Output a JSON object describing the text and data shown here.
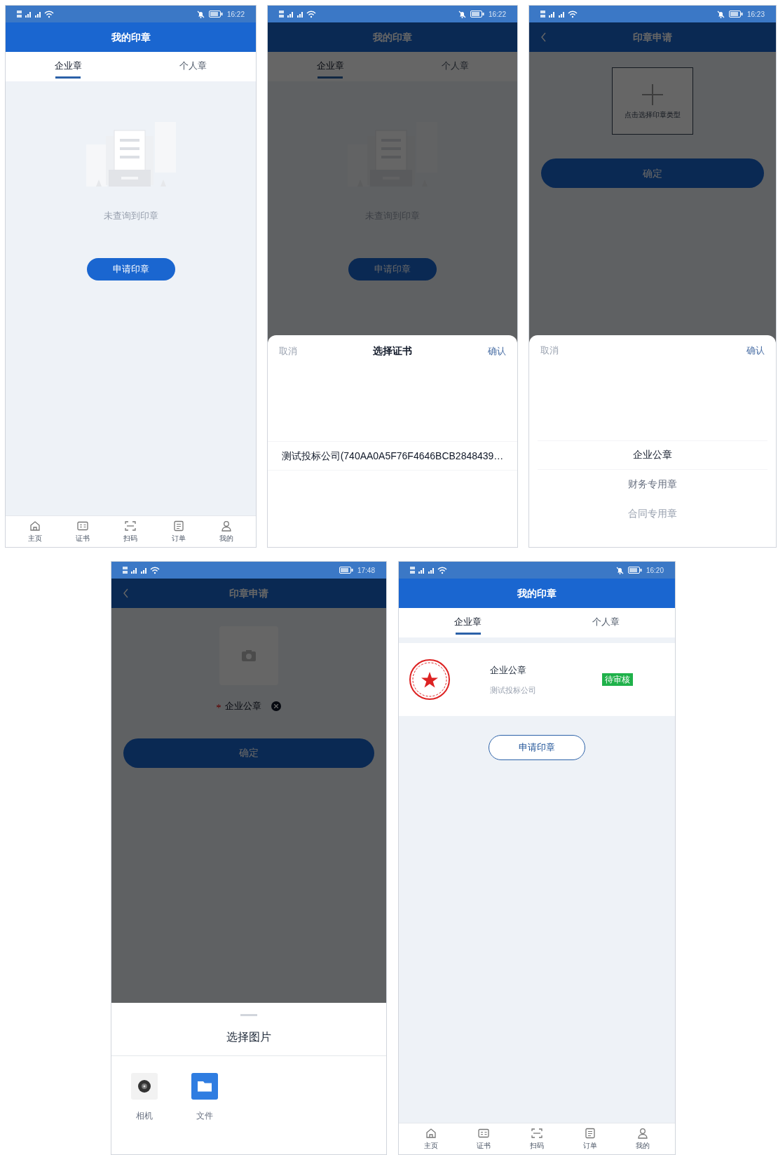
{
  "screens": [
    {
      "status_bar": {
        "time": "16:22",
        "muted": true
      },
      "header": {
        "title": "我的印章",
        "back": false
      },
      "dimmed": false,
      "tabs": [
        {
          "label": "企业章",
          "selected": true
        },
        {
          "label": "个人章",
          "selected": false
        }
      ],
      "empty_state": {
        "text": "未查询到印章"
      },
      "apply_button": {
        "label": "申请印章",
        "kind": "filled"
      },
      "bottom_nav": [
        {
          "label": "主页",
          "kind": "home"
        },
        {
          "label": "证书",
          "kind": "card"
        },
        {
          "label": "扫码",
          "kind": "scan"
        },
        {
          "label": "订单",
          "kind": "order"
        },
        {
          "label": "我的",
          "kind": "user"
        }
      ]
    },
    {
      "status_bar": {
        "time": "16:22",
        "muted": true
      },
      "header": {
        "title": "我的印章",
        "back": false
      },
      "dimmed": true,
      "tabs": [
        {
          "label": "企业章",
          "selected": true
        },
        {
          "label": "个人章",
          "selected": false
        }
      ],
      "empty_state": {
        "text": "未查询到印章"
      },
      "apply_button": {
        "label": "申请印章",
        "kind": "filled"
      },
      "sheet": {
        "cancel": "取消",
        "title": "选择证书",
        "confirm": "确认",
        "options": [
          {
            "label": "测试投标公司(740AA0A5F76F4646BCB2848439…",
            "selected": true
          }
        ]
      }
    },
    {
      "status_bar": {
        "time": "16:23",
        "muted": true
      },
      "header": {
        "title": "印章申请",
        "back": true
      },
      "dimmed": true,
      "seal_picker": {
        "kind": "add",
        "hint": "点击选择印章类型"
      },
      "confirm_button": "确定",
      "sheet": {
        "cancel": "取消",
        "confirm": "确认",
        "options": [
          {
            "label": "企业公章",
            "selected": true
          },
          {
            "label": "财务专用章",
            "selected": false
          },
          {
            "label": "合同专用章",
            "selected": false
          }
        ]
      }
    },
    {
      "status_bar": {
        "time": "17:48",
        "muted": false
      },
      "header": {
        "title": "印章申请",
        "back": true
      },
      "dimmed": true,
      "seal_picker": {
        "kind": "photo",
        "label": "企业公章",
        "required": true,
        "removable": true
      },
      "confirm_button": "确定",
      "image_sheet": {
        "title": "选择图片",
        "sources": [
          {
            "label": "相机",
            "kind": "camera"
          },
          {
            "label": "文件",
            "kind": "folder"
          }
        ]
      }
    },
    {
      "status_bar": {
        "time": "16:20",
        "muted": true
      },
      "header": {
        "title": "我的印章",
        "back": false
      },
      "dimmed": false,
      "tabs": [
        {
          "label": "企业章",
          "selected": true
        },
        {
          "label": "个人章",
          "selected": false
        }
      ],
      "seal_list": [
        {
          "name": "企业公章",
          "company": "测试投标公司",
          "status": "待审核"
        }
      ],
      "apply_button": {
        "label": "申请印章",
        "kind": "outline"
      },
      "bottom_nav": [
        {
          "label": "主页",
          "kind": "home"
        },
        {
          "label": "证书",
          "kind": "card"
        },
        {
          "label": "扫码",
          "kind": "scan"
        },
        {
          "label": "订单",
          "kind": "order"
        },
        {
          "label": "我的",
          "kind": "user"
        }
      ]
    }
  ]
}
